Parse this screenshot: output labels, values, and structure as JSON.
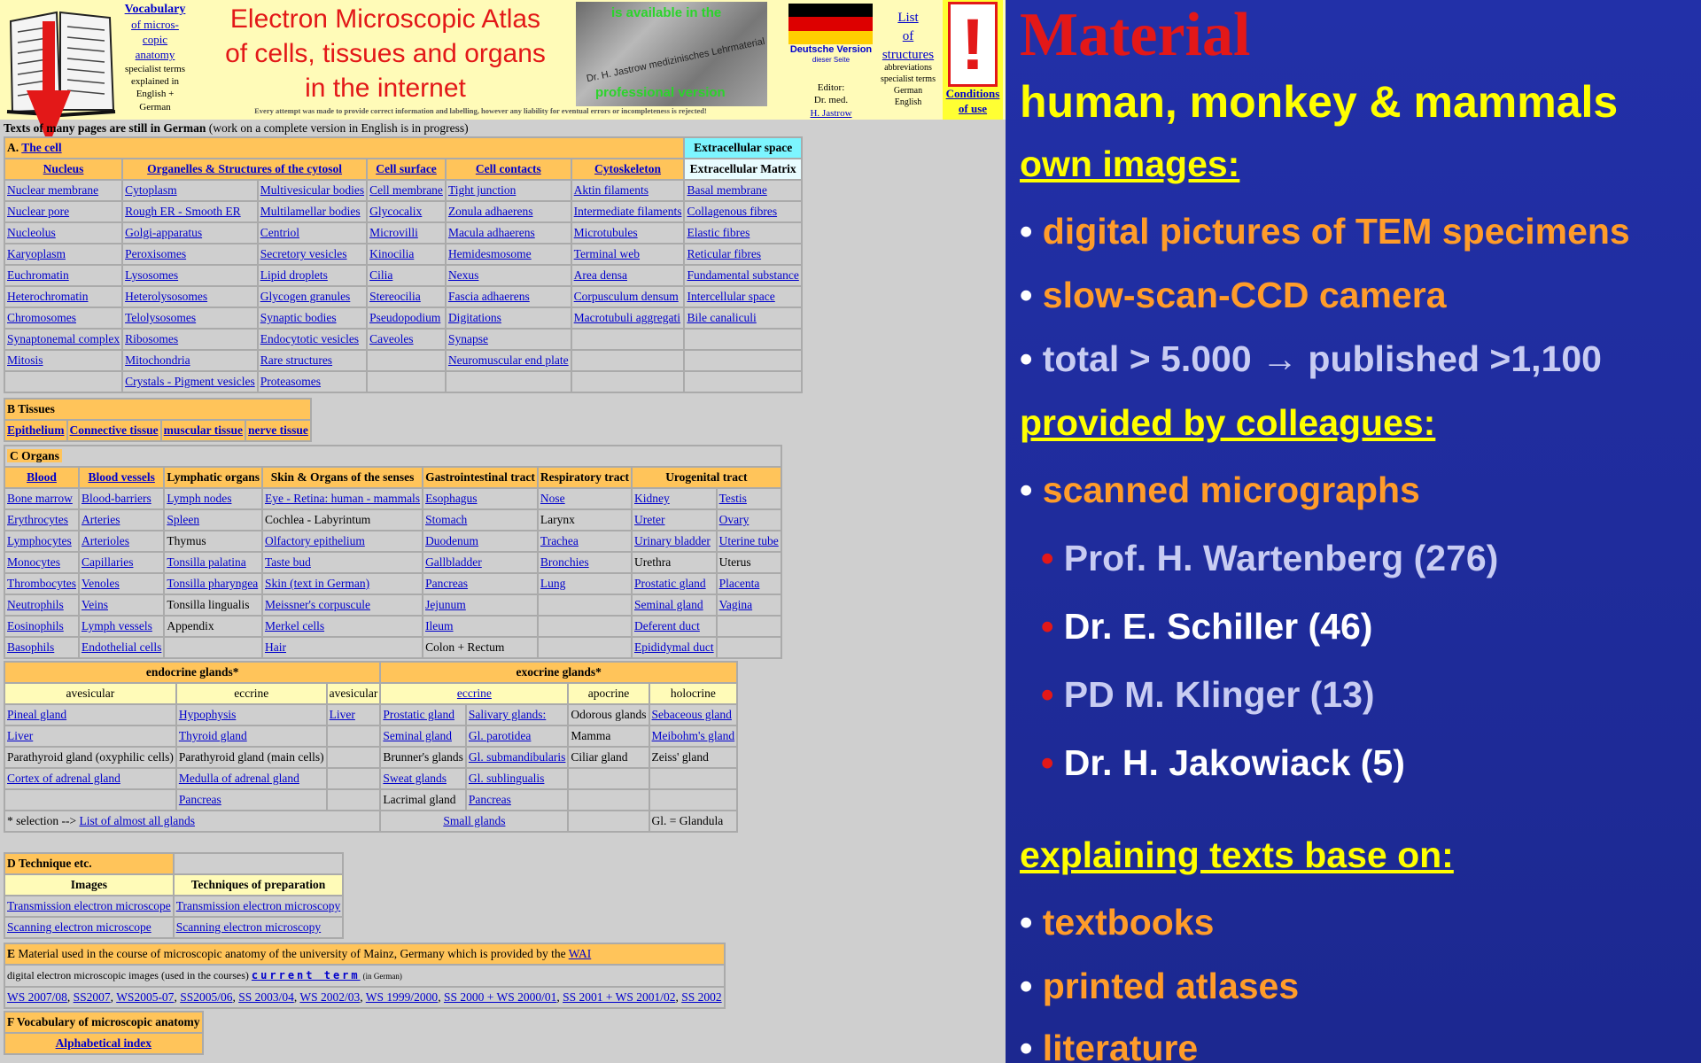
{
  "header": {
    "vocab": {
      "l1": "Vocabulary",
      "l2": "of micros-",
      "l3": "copic",
      "l4": "anatomy",
      "l5": "specialist terms",
      "l6": "explained in",
      "l7": "English +",
      "l8": "German"
    },
    "title": {
      "l1": "Electron Microscopic Atlas",
      "l2": "of cells, tissues and organs",
      "l3": "in the internet"
    },
    "disclaimer": "Every attempt was made to provide correct information and labelling, however any liability for eventual errors or incompleteness is rejected!",
    "promo": {
      "l1": "is available in the",
      "l2": "Dr. H. Jastrow medizinisches Lehrmaterial",
      "l3": "professional version"
    },
    "german": {
      "l1": "Deutsche Version",
      "l2": "dieser Seite"
    },
    "editor": {
      "l1": "Editor:",
      "l2": "Dr. med.",
      "l3": "H. Jastrow"
    },
    "list": {
      "l1": "List",
      "l2": "of",
      "l3": "structures",
      "l4": "abbreviations",
      "l5": "specialist terms",
      "l6": "German",
      "l7": "English"
    },
    "conditions": {
      "mark": "!",
      "l1": "Conditions",
      "l2": "of use"
    },
    "note_bold": "Texts of many pages are still in German",
    "note_rest": " (work on a complete version in English is in progress)",
    "flag_colors": [
      "#000000",
      "#dd0000",
      "#ffce00"
    ]
  },
  "A": {
    "letter": "A.",
    "title": "The cell",
    "extra": "Extracellular space",
    "heads": [
      "Nucleus",
      "Organelles & Structures of the cytosol",
      "Cell surface",
      "Cell contacts",
      "Cytoskeleton",
      "Extracellular Matrix"
    ],
    "rows": [
      [
        "Nuclear membrane",
        "Cytoplasm",
        "Multivesicular bodies",
        "Cell membrane",
        "Tight junction",
        "Aktin filaments",
        "Basal membrane"
      ],
      [
        "Nuclear pore",
        "Rough ER - Smooth ER",
        "Multilamellar bodies",
        "Glycocalix",
        "Zonula adhaerens",
        "Intermediate filaments",
        "Collagenous fibres"
      ],
      [
        "Nucleolus",
        "Golgi-apparatus",
        "Centriol",
        "Microvilli",
        "Macula adhaerens",
        "Microtubules",
        "Elastic fibres"
      ],
      [
        "Karyoplasm",
        "Peroxisomes",
        "Secretory vesicles",
        "Kinocilia",
        "Hemidesmosome",
        "Terminal web",
        "Reticular fibres"
      ],
      [
        "Euchromatin",
        "Lysosomes",
        "Lipid droplets",
        "Cilia",
        "Nexus",
        "Area densa",
        "Fundamental substance"
      ],
      [
        "Heterochromatin",
        "Heterolysosomes",
        "Glycogen granules",
        "Stereocilia",
        "Fascia adhaerens",
        "Corpusculum densum",
        "Intercellular space"
      ],
      [
        "Chromosomes",
        "Telolysosomes",
        "Synaptic bodies",
        "Pseudopodium",
        "Digitations",
        "Macrotubuli aggregati",
        "Bile canaliculi"
      ],
      [
        "Synaptonemal complex",
        "Ribosomes",
        "Endocytotic vesicles",
        "Caveoles",
        "Synapse",
        "",
        ""
      ],
      [
        "Mitosis",
        "Mitochondria",
        "Rare structures",
        "",
        "Neuromuscular end plate",
        "",
        ""
      ],
      [
        "",
        "Crystals - Pigment vesicles",
        "Proteasomes",
        "",
        "",
        "",
        ""
      ]
    ]
  },
  "B": {
    "letter": "B",
    "title": "Tissues",
    "items": [
      "Epithelium",
      "Connective tissue",
      "muscular tissue",
      "nerve tissue"
    ]
  },
  "C": {
    "letter": "C",
    "title": "Organs",
    "heads": [
      "Blood",
      "Blood vessels",
      "Lymphatic organs",
      "Skin & Organs of the senses",
      "Gastrointestinal tract",
      "Respiratory tract",
      "Urogenital tract"
    ],
    "rows": [
      [
        "Bone marrow",
        "Blood-barriers",
        "Lymph nodes",
        "Eye - Retina: human - mammals",
        "Esophagus",
        "Nose",
        "Kidney",
        "Testis"
      ],
      [
        "Erythrocytes",
        "Arteries",
        "Spleen",
        "Cochlea - Labyrintum",
        "Stomach",
        "Larynx",
        "Ureter",
        "Ovary"
      ],
      [
        "Lymphocytes",
        "Arterioles",
        "Thymus",
        "Olfactory epithelium",
        "Duodenum",
        "Trachea",
        "Urinary bladder",
        "Uterine tube"
      ],
      [
        "Monocytes",
        "Capillaries",
        "Tonsilla palatina",
        "Taste bud",
        "Gallbladder",
        "Bronchies",
        "Urethra",
        "Uterus"
      ],
      [
        "Thrombocytes",
        "Venoles",
        "Tonsilla pharyngea",
        "Skin (text in German)",
        "Pancreas",
        "Lung",
        "Prostatic gland",
        "Placenta"
      ],
      [
        "Neutrophils",
        "Veins",
        "Tonsilla lingualis",
        "Meissner's corpuscule",
        "Jejunum",
        "",
        "Seminal gland",
        "Vagina"
      ],
      [
        "Eosinophils",
        "Lymph vessels",
        "Appendix",
        "Merkel cells",
        "Ileum",
        "",
        "Deferent duct",
        ""
      ],
      [
        "Basophils",
        "Endothelial cells",
        "",
        "Hair",
        "Colon + Rectum",
        "",
        "Epididymal duct",
        ""
      ]
    ]
  },
  "glands": {
    "endo": "endocrine glands*",
    "exo": "exocrine glands*",
    "sub": [
      "avesicular",
      "eccrine",
      "avesicular",
      "eccrine",
      "apocrine",
      "holocrine"
    ],
    "rows": [
      [
        "Pineal gland",
        "Hypophysis",
        "Liver",
        "Prostatic gland",
        "Salivary glands:",
        "Odorous glands",
        "Sebaceous gland"
      ],
      [
        "Liver",
        "Thyroid gland",
        "",
        "Seminal gland",
        "Gl. parotidea",
        "Mamma",
        "Meibohm's gland"
      ],
      [
        "Parathyroid gland (oxyphilic cells)",
        "Parathyroid gland (main cells)",
        "",
        "Brunner's glands",
        "Gl. submandibularis",
        "Ciliar gland",
        "Zeiss' gland"
      ],
      [
        "Cortex of adrenal gland",
        "Medulla of adrenal gland",
        "",
        "Sweat glands",
        "Gl. sublingualis",
        "",
        ""
      ],
      [
        "",
        "Pancreas",
        "",
        "Lacrimal gland",
        "Pancreas",
        "",
        ""
      ]
    ],
    "selection": "* selection --> ",
    "selection_link": "List of almost all glands",
    "small": "Small glands",
    "gl": "Gl. = Glandula"
  },
  "D": {
    "letter": "D",
    "title": "Technique etc.",
    "heads": [
      "Images",
      "Techniques of preparation"
    ],
    "rows": [
      [
        "Transmission electron microscope",
        "Transmission electron microscopy"
      ],
      [
        "Scanning electron microscope",
        "Scanning electron microscopy"
      ]
    ]
  },
  "E": {
    "letter": "E",
    "text": "Material used in the course of microscopic anatomy of the university of Mainz, Germany which is provided by the ",
    "wai": "WAI",
    "digital": "digital electron microscopic images (used in the courses) ",
    "current": "current term",
    "ingerman": "(in German)",
    "terms": [
      "WS 2007/08",
      "SS2007",
      "WS2005-07",
      "SS2005/06",
      "SS 2003/04",
      "WS 2002/03",
      "WS 1999/2000",
      "SS 2000 + WS 2000/01",
      "SS 2001 + WS 2001/02",
      "SS 2002"
    ]
  },
  "F": {
    "letter": "F",
    "title": "Vocabulary of microscopic anatomy",
    "link": "Alphabetical index"
  },
  "slide": {
    "title": "Material",
    "subtitle": "human, monkey & mammals",
    "own": "own images:",
    "b1": "digital pictures of TEM specimens",
    "b2": "slow-scan-CCD camera",
    "b3": "total > 5.000 → published >1,100",
    "prov": "provided by colleagues:",
    "b4": "scanned micrographs",
    "s1": "Prof. H. Wartenberg (276)",
    "s2": "Dr. E. Schiller (46)",
    "s3": "PD M. Klinger (13)",
    "s4": "Dr. H. Jakowiack (5)",
    "expl": "explaining texts base on:",
    "b5": "textbooks",
    "b6": "printed atlases",
    "b7": "literature",
    "bullet": "•"
  }
}
